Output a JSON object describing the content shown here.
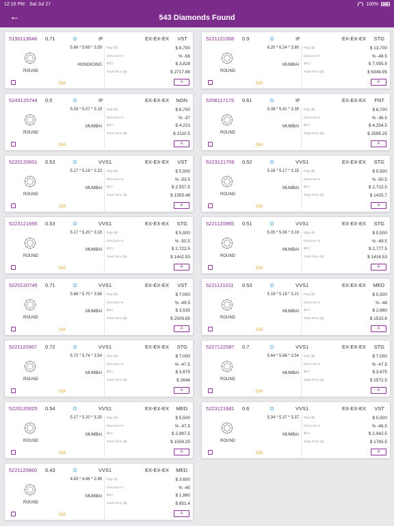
{
  "status": {
    "time": "12:16 PM",
    "date": "Sat Jul 27",
    "battery": "100%"
  },
  "header": {
    "title": "543 Diamonds Found",
    "back_icon": "back-arrow-icon"
  },
  "labels": {
    "rap": "Rap ($)",
    "discount": "Discount %",
    "ct": "$/Ct",
    "total": "Total Price ($)",
    "action": "A"
  },
  "colors": {
    "brand": "#7b2b8a",
    "stock": "#8a2d95",
    "color_grade": "#2a8ed3",
    "lab": "#e1a21f"
  },
  "diamonds": [
    {
      "stock": "5190113648",
      "carat": "0.71",
      "color": "D",
      "clarity": "IF",
      "cut": "EX-EX-EX",
      "fluor": "VST",
      "meas": "5.66 * 5.69 * 3.59",
      "loc": "HONGKONG",
      "shape": "ROUND",
      "lab": "GIA",
      "rap": "$ 8,700",
      "disc": "% -56",
      "ct": "$ 3,828",
      "total": "$ 2717.88"
    },
    {
      "stock": "5221121068",
      "carat": "0.9",
      "color": "D",
      "clarity": "IF",
      "cut": "EX-EX-EX",
      "fluor": "STG",
      "meas": "6.20 * 6.24 * 3.80",
      "loc": "MUMBAI",
      "shape": "ROUND",
      "lab": "GIA",
      "rap": "$ 13,700",
      "disc": "% -48.5",
      "ct": "$ 7,055.5",
      "total": "$ 6349.95"
    },
    {
      "stock": "5243125744",
      "carat": "0.5",
      "color": "D",
      "clarity": "IF",
      "cut": "EX-EX-EX",
      "fluor": "NON",
      "meas": "5.03 * 5.07 * 3.19",
      "loc": "MUMBAI",
      "shape": "ROUND",
      "lab": "GIA",
      "rap": "$ 6,700",
      "disc": "% -37",
      "ct": "$ 4,221",
      "total": "$ 2110.5"
    },
    {
      "stock": "5208117175",
      "carat": "0.61",
      "color": "D",
      "clarity": "IF",
      "cut": "EX-EX-EX",
      "fluor": "FNT",
      "meas": "5.38 * 5.41 * 3.39",
      "loc": "MUMBAI",
      "shape": "ROUND",
      "lab": "GIA",
      "rap": "$ 6,700",
      "disc": "% -36.5",
      "ct": "$ 4,254.5",
      "total": "$ 2595.25"
    },
    {
      "stock": "5220120601",
      "carat": "0.53",
      "color": "D",
      "clarity": "VVS1",
      "cut": "EX-EX-EX",
      "fluor": "VST",
      "meas": "5.17 * 5.19 * 3.23",
      "loc": "MUMBAI",
      "shape": "ROUND",
      "lab": "GIA",
      "rap": "$ 5,500",
      "disc": "% -53.5",
      "ct": "$ 2,557.5",
      "total": "$ 1355.48"
    },
    {
      "stock": "5223121706",
      "carat": "0.52",
      "color": "D",
      "clarity": "VVS1",
      "cut": "EX-EX-EX",
      "fluor": "STG",
      "meas": "5.16 * 5.17 * 3.15",
      "loc": "MUMBAI",
      "shape": "ROUND",
      "lab": "GIA",
      "rap": "$ 5,500",
      "disc": "% -50.5",
      "ct": "$ 2,722.5",
      "total": "$ 1415.7"
    },
    {
      "stock": "5223121695",
      "carat": "0.53",
      "color": "D",
      "clarity": "VVS1",
      "cut": "EX-EX-EX",
      "fluor": "STG",
      "meas": "5.17 * 5.20 * 3.19",
      "loc": "MUMBAI",
      "shape": "ROUND",
      "lab": "GIA",
      "rap": "$ 5,500",
      "disc": "% -50.5",
      "ct": "$ 2,722.5",
      "total": "$ 1442.93"
    },
    {
      "stock": "5221120985",
      "carat": "0.51",
      "color": "D",
      "clarity": "VVS1",
      "cut": "EX-EX-EX",
      "fluor": "STG",
      "meas": "5.05 * 5.08 * 3.19",
      "loc": "MUMBAI",
      "shape": "ROUND",
      "lab": "GIA",
      "rap": "$ 5,500",
      "disc": "% -49.5",
      "ct": "$ 2,777.5",
      "total": "$ 1416.53"
    },
    {
      "stock": "5220120745",
      "carat": "0.71",
      "color": "D",
      "clarity": "VVS1",
      "cut": "EX-EX-EX",
      "fluor": "VST",
      "meas": "5.66 * 5.70 * 3.58",
      "loc": "MUMBAI",
      "shape": "ROUND",
      "lab": "GIA",
      "rap": "$ 7,000",
      "disc": "% -49.5",
      "ct": "$ 3,535",
      "total": "$ 2509.85"
    },
    {
      "stock": "5221121011",
      "carat": "0.53",
      "color": "D",
      "clarity": "VVS1",
      "cut": "EX-EX-EX",
      "fluor": "MED",
      "meas": "5.18 * 5.19 * 3.21",
      "loc": "MUMBAI",
      "shape": "ROUND",
      "lab": "GIA",
      "rap": "$ 5,500",
      "disc": "% -48",
      "ct": "$ 2,860",
      "total": "$ 1515.8"
    },
    {
      "stock": "5221120967",
      "carat": "0.72",
      "color": "D",
      "clarity": "VVS1",
      "cut": "EX-EX-EX",
      "fluor": "STG",
      "meas": "5.72 * 5.74 * 3.54",
      "loc": "MUMBAI",
      "shape": "ROUND",
      "lab": "GIA",
      "rap": "$ 7,000",
      "disc": "% -47.5",
      "ct": "$ 3,675",
      "total": "$ 2646"
    },
    {
      "stock": "5227122587",
      "carat": "0.7",
      "color": "D",
      "clarity": "VVS1",
      "cut": "EX-EX-EX",
      "fluor": "STG",
      "meas": "5.64 * 5.68 * 3.54",
      "loc": "MUMBAI",
      "shape": "ROUND",
      "lab": "GIA",
      "rap": "$ 7,000",
      "disc": "% -47.5",
      "ct": "$ 3,675",
      "total": "$ 2572.5"
    },
    {
      "stock": "5220120625",
      "carat": "0.54",
      "color": "D",
      "clarity": "VVS1",
      "cut": "EX-EX-EX",
      "fluor": "MED",
      "meas": "5.17 * 5.20 * 3.25",
      "loc": "MUMBAI",
      "shape": "ROUND",
      "lab": "GIA",
      "rap": "$ 5,500",
      "disc": "% -47.5",
      "ct": "$ 2,887.5",
      "total": "$ 1559.25"
    },
    {
      "stock": "5223121681",
      "carat": "0.6",
      "color": "D",
      "clarity": "VVS1",
      "cut": "EX-EX-EX",
      "fluor": "VST",
      "meas": "5.34 * 5.37 * 3.37",
      "loc": "MUMBAI",
      "shape": "ROUND",
      "lab": "GIA",
      "rap": "$ 5,500",
      "disc": "% -46.5",
      "ct": "$ 2,942.5",
      "total": "$ 1765.5"
    },
    {
      "stock": "5221120860",
      "carat": "0.43",
      "color": "D",
      "clarity": "VVS1",
      "cut": "EX-EX-EX",
      "fluor": "MED",
      "meas": "4.83 * 4.86 * 2.99",
      "loc": "MUMBAI",
      "shape": "ROUND",
      "lab": "GIA",
      "rap": "$ 3,600",
      "disc": "% -45",
      "ct": "$ 1,980",
      "total": "$ 851.4"
    }
  ]
}
